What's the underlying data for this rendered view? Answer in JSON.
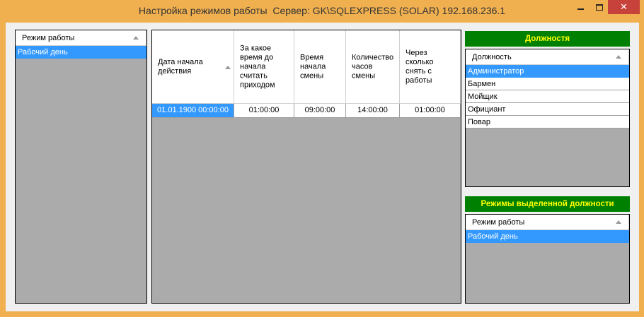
{
  "window": {
    "title": "Настройка режимов работы  Сервер: GK\\SQLEXPRESS (SOLAR) 192.168.236.1",
    "close_glyph": "✕"
  },
  "modes_list": {
    "header": "Режим работы",
    "items": [
      "Рабочий день"
    ]
  },
  "schedule_grid": {
    "columns": [
      "Дата начала действия",
      "За какое время до начала считать приходом",
      "Время начала смены",
      "Количество часов смены",
      "Через сколько снять с работы"
    ],
    "rows": [
      [
        "01.01.1900 00:00:00",
        "01:00:00",
        "09:00:00",
        "14:00:00",
        "01:00:00"
      ]
    ]
  },
  "positions": {
    "band_title": "Должностя",
    "header": "Должность",
    "items": [
      "Администратор",
      "Бармен",
      "Мойщик",
      "Официант",
      "Повар"
    ]
  },
  "selected_position_modes": {
    "band_title": "Режимы выделенной должности",
    "header": "Режим работы",
    "items": [
      "Рабочий день"
    ]
  },
  "colors": {
    "frame": "#f0b050",
    "selection": "#3399ff",
    "band_bg": "#008000",
    "band_text": "#ffff00",
    "close_button": "#c7423a"
  }
}
